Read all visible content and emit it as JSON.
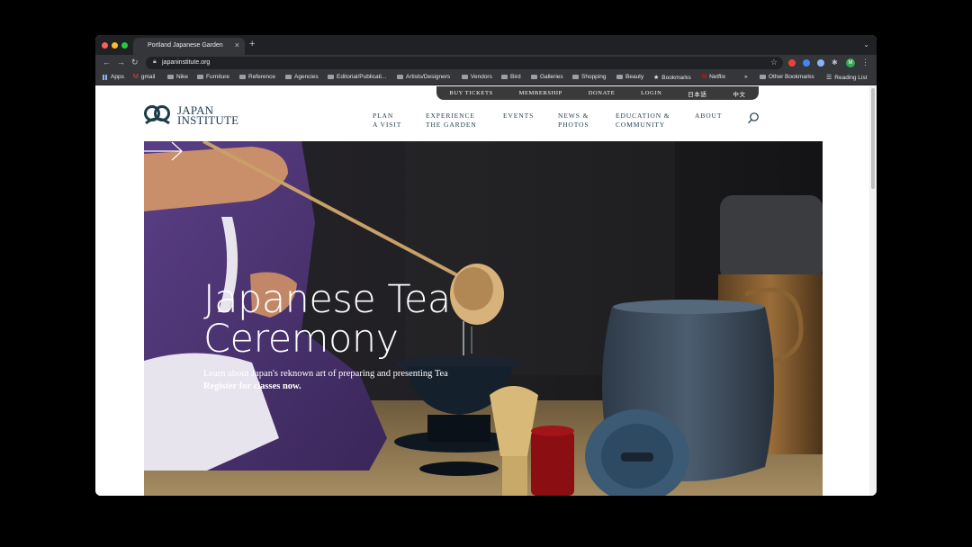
{
  "browser": {
    "tab_title": "Portland Japanese Garden",
    "tab_close": "×",
    "new_tab": "+",
    "url": "japaninstitute.org",
    "avatar_initial": "M",
    "bookmarks": [
      {
        "label": "Apps",
        "icon": "apps-icon"
      },
      {
        "label": "gmail",
        "icon": "gmail-icon"
      },
      {
        "label": "Nike",
        "icon": "folder-icon"
      },
      {
        "label": "Furniture",
        "icon": "folder-icon"
      },
      {
        "label": "Reference",
        "icon": "folder-icon"
      },
      {
        "label": "Agencies",
        "icon": "folder-icon"
      },
      {
        "label": "Editorial/Publicati...",
        "icon": "folder-icon"
      },
      {
        "label": "Artists/Designers",
        "icon": "folder-icon"
      },
      {
        "label": "Vendors",
        "icon": "folder-icon"
      },
      {
        "label": "Bird",
        "icon": "folder-icon"
      },
      {
        "label": "Galleries",
        "icon": "folder-icon"
      },
      {
        "label": "Shopping",
        "icon": "folder-icon"
      },
      {
        "label": "Beauty",
        "icon": "folder-icon"
      },
      {
        "label": "Bookmarks",
        "icon": "star-icon"
      },
      {
        "label": "Netflix",
        "icon": "netflix-icon"
      },
      {
        "label": "»",
        "icon": "overflow-icon"
      },
      {
        "label": "Other Bookmarks",
        "icon": "folder-icon"
      },
      {
        "label": "Reading List",
        "icon": "reading-list-icon"
      }
    ]
  },
  "utility_nav": [
    "BUY TICKETS",
    "MEMBERSHIP",
    "DONATE",
    "LOGIN",
    "日本語",
    "中文"
  ],
  "logo": {
    "line1": "JAPAN",
    "line2": "INSTITUTE"
  },
  "main_nav": [
    {
      "line1": "PLAN",
      "line2": "A VISIT"
    },
    {
      "line1": "EXPERIENCE",
      "line2": "THE GARDEN"
    },
    {
      "line1": "EVENTS",
      "line2": ""
    },
    {
      "line1": "NEWS &",
      "line2": "PHOTOS"
    },
    {
      "line1": "EDUCATION &",
      "line2": "COMMUNITY"
    },
    {
      "line1": "ABOUT",
      "line2": ""
    }
  ],
  "hero": {
    "title_line1": "Japanese Tea",
    "title_line2": "Ceremony",
    "subtitle": "Learn about Japan's reknown art of preparing and presenting Tea",
    "cta": "Register for classes now."
  },
  "colors": {
    "brand_navy": "#1d3c4a",
    "utility_bar": "#3a3a3a",
    "chrome_dark": "#202124",
    "chrome_toolbar": "#35363a"
  }
}
